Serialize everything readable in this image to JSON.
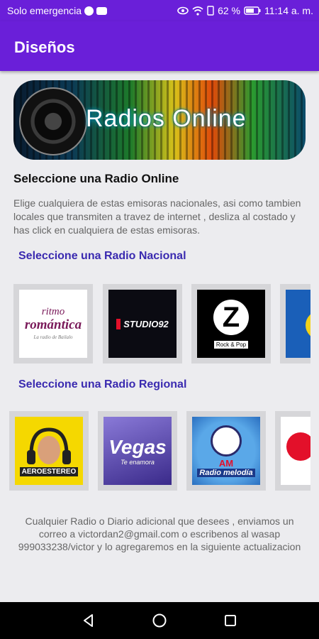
{
  "status": {
    "carrier": "Solo emergencia",
    "battery": "62 %",
    "time": "11:14 a. m."
  },
  "appbar": {
    "title": "Diseños"
  },
  "banner": {
    "text": "Radios Online"
  },
  "intro": {
    "heading": "Seleccione una Radio Online",
    "description": "Elige cualquiera de estas emisoras nacionales, asi como tambien locales que transmiten a travez de internet , desliza al costado y has click en cualquiera de estas emisoras."
  },
  "national": {
    "title": "Seleccione una Radio Nacional",
    "logos": [
      {
        "name": "Ritmo Romántica",
        "line1": "ritmo",
        "line2": "romántica",
        "tag": "La radio de Bailalo"
      },
      {
        "name": "Studio 92",
        "text": "STUDIO92"
      },
      {
        "name": "Radio Z Rock & Pop",
        "letter": "Z",
        "tag": "Rock & Pop"
      },
      {
        "name": "partial logo"
      }
    ]
  },
  "regional": {
    "title": "Seleccione una Radio Regional",
    "logos": [
      {
        "name": "Aeroestereo",
        "text": "AEROESTEREO"
      },
      {
        "name": "Vegas",
        "text": "Vegas",
        "sub": "Te enamora"
      },
      {
        "name": "Radio Melodia AM",
        "am": "AM",
        "text": "Radio melodía"
      },
      {
        "name": "partial logo"
      }
    ]
  },
  "footer": {
    "text": "Cualquier Radio o Diario adicional que desees , enviamos un correo a victordan2@gmail.com o escribenos al wasap 999033238/victor y lo agregaremos en la siguiente actualizacion"
  }
}
